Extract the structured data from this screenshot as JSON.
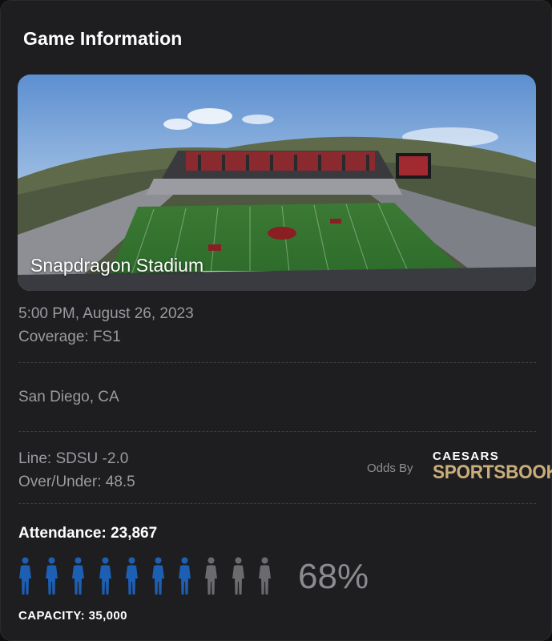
{
  "header": {
    "title": "Game Information"
  },
  "venue": {
    "name": "Snapdragon Stadium",
    "image_alt": "stadium-photo"
  },
  "game": {
    "datetime": "5:00 PM, August 26, 2023",
    "coverage": "Coverage: FS1",
    "location": "San Diego, CA"
  },
  "odds": {
    "line": "Line: SDSU -2.0",
    "over_under": "Over/Under: 48.5",
    "odds_by": "Odds By",
    "sportsbook_top": "CAESARS",
    "sportsbook_bottom": "SPORTSBOOK"
  },
  "attendance": {
    "label": "Attendance: 23,867",
    "percent_label": "68%",
    "fraction": 0.68,
    "icons_total": 10,
    "icons_filled": 7,
    "capacity_label": "CAPACITY: 35,000",
    "filled_color": "#1d5fb3",
    "empty_color": "#6a6a6f"
  }
}
